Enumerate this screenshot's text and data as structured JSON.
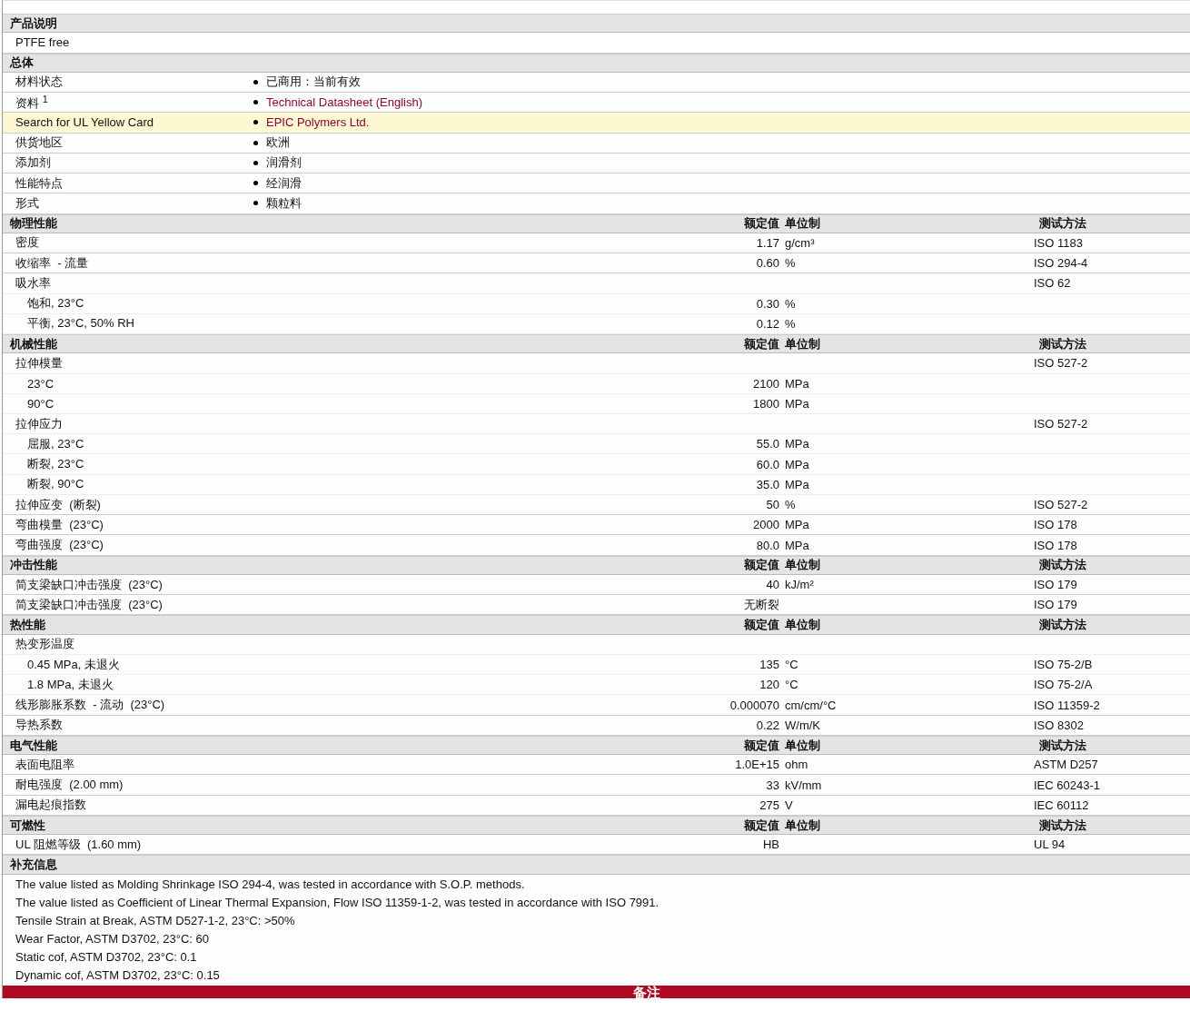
{
  "sections": [
    {
      "title": "产品说明",
      "rows": [
        {
          "kind": "note",
          "text": "PTFE free"
        }
      ]
    },
    {
      "title": "总体",
      "rows": [
        {
          "kind": "info",
          "label": "材料状态",
          "value": "已商用：当前有效",
          "link": false,
          "highlighted": false
        },
        {
          "kind": "info",
          "label": "资料 $^{1}$",
          "value": "Technical Datasheet (English)",
          "link": true,
          "highlighted": false
        },
        {
          "kind": "info",
          "label": "Search for UL Yellow Card",
          "value": "EPIC Polymers Ltd.",
          "link": true,
          "highlighted": true
        },
        {
          "kind": "info",
          "label": "供货地区",
          "value": "欧洲",
          "link": false,
          "highlighted": false
        },
        {
          "kind": "info",
          "label": "添加剂",
          "value": "润滑剂",
          "link": false,
          "highlighted": false
        },
        {
          "kind": "info",
          "label": "性能特点",
          "value": "经润滑",
          "link": false,
          "highlighted": false
        },
        {
          "kind": "info",
          "label": "形式",
          "value": "颗粒料",
          "link": false,
          "highlighted": false
        }
      ]
    },
    {
      "title": "物理性能",
      "columns": {
        "value": "额定值",
        "unit": "单位制",
        "method": "测试方法"
      },
      "rows": [
        {
          "kind": "prop",
          "label": "密度",
          "value": "1.17",
          "unit": "g/cm³",
          "method": "ISO 1183"
        },
        {
          "kind": "prop",
          "label": "收缩率  - 流量",
          "value": "0.60",
          "unit": "%",
          "method": "ISO 294-4"
        },
        {
          "kind": "prop",
          "label": "吸水率",
          "method": "ISO 62",
          "children": [
            {
              "kind": "prop",
              "label": "饱和, 23°C",
              "value": "0.30",
              "unit": "%"
            },
            {
              "kind": "prop",
              "label": "平衡, 23°C, 50% RH",
              "value": "0.12",
              "unit": "%"
            }
          ]
        }
      ]
    },
    {
      "title": "机械性能",
      "columns": {
        "value": "额定值",
        "unit": "单位制",
        "method": "测试方法"
      },
      "rows": [
        {
          "kind": "prop",
          "label": "拉伸模量",
          "method": "ISO 527-2",
          "children": [
            {
              "kind": "prop",
              "label": "23°C",
              "value": "2100",
              "unit": "MPa"
            },
            {
              "kind": "prop",
              "label": "90°C",
              "value": "1800",
              "unit": "MPa"
            }
          ]
        },
        {
          "kind": "prop",
          "label": "拉伸应力",
          "method": "ISO 527-2",
          "children": [
            {
              "kind": "prop",
              "label": "屈服, 23°C",
              "value": "55.0",
              "unit": "MPa"
            },
            {
              "kind": "prop",
              "label": "断裂, 23°C",
              "value": "60.0",
              "unit": "MPa"
            },
            {
              "kind": "prop",
              "label": "断裂, 90°C",
              "value": "35.0",
              "unit": "MPa"
            }
          ]
        },
        {
          "kind": "prop",
          "label": "拉伸应变  (断裂)",
          "value": "50",
          "unit": "%",
          "method": "ISO 527-2"
        },
        {
          "kind": "prop",
          "label": "弯曲模量  (23°C)",
          "value": "2000",
          "unit": "MPa",
          "method": "ISO 178"
        },
        {
          "kind": "prop",
          "label": "弯曲强度  (23°C)",
          "value": "80.0",
          "unit": "MPa",
          "method": "ISO 178"
        }
      ]
    },
    {
      "title": "冲击性能",
      "columns": {
        "value": "额定值",
        "unit": "单位制",
        "method": "测试方法"
      },
      "rows": [
        {
          "kind": "prop",
          "label": "简支梁缺口冲击强度  (23°C)",
          "value": "40",
          "unit": "kJ/m²",
          "method": "ISO 179"
        },
        {
          "kind": "prop",
          "label": "简支梁缺口冲击强度  (23°C)",
          "value": "无断裂",
          "method": "ISO 179"
        }
      ]
    },
    {
      "title": "热性能",
      "columns": {
        "value": "额定值",
        "unit": "单位制",
        "method": "测试方法"
      },
      "rows": [
        {
          "kind": "prop",
          "label": "热变形温度",
          "children": [
            {
              "kind": "prop",
              "label": "0.45 MPa, 未退火",
              "value": "135",
              "unit": "°C",
              "method": "ISO 75-2/B"
            },
            {
              "kind": "prop",
              "label": "1.8 MPa, 未退火",
              "value": "120",
              "unit": "°C",
              "method": "ISO 75-2/A"
            }
          ]
        },
        {
          "kind": "prop",
          "label": "线形膨胀系数  - 流动  (23°C)",
          "value": "0.000070",
          "unit": "cm/cm/°C",
          "method": "ISO 11359-2"
        },
        {
          "kind": "prop",
          "label": "导热系数",
          "value": "0.22",
          "unit": "W/m/K",
          "method": "ISO 8302"
        }
      ]
    },
    {
      "title": "电气性能",
      "columns": {
        "value": "额定值",
        "unit": "单位制",
        "method": "测试方法"
      },
      "rows": [
        {
          "kind": "prop",
          "label": "表面电阻率",
          "value": "1.0E+15",
          "unit": "ohm",
          "method": "ASTM D257"
        },
        {
          "kind": "prop",
          "label": "耐电强度  (2.00 mm)",
          "value": "33",
          "unit": "kV/mm",
          "method": "IEC 60243-1"
        },
        {
          "kind": "prop",
          "label": "漏电起痕指数",
          "value": "275",
          "unit": "V",
          "method": "IEC 60112"
        }
      ]
    },
    {
      "title": "可燃性",
      "columns": {
        "value": "额定值",
        "unit": "单位制",
        "method": "测试方法"
      },
      "rows": [
        {
          "kind": "prop",
          "label": "UL 阻燃等级  (1.60 mm)",
          "value": "HB",
          "method": "UL 94"
        }
      ]
    },
    {
      "title": "补充信息",
      "rows": [
        {
          "kind": "notes",
          "lines": [
            "The value listed as Molding Shrinkage ISO 294-4, was tested in accordance with S.O.P. methods.",
            "The value listed as Coefficient of Linear Thermal Expansion, Flow ISO 11359-1-2, was tested in accordance with ISO 7991.",
            "Tensile Strain at Break, ASTM D527-1-2, 23°C: >50%",
            "Wear Factor, ASTM D3702, 23°C: 60",
            "Static cof, ASTM D3702, 23°C: 0.1",
            "Dynamic cof, ASTM D3702, 23°C: 0.15"
          ]
        }
      ]
    }
  ],
  "footer": {
    "title": "备注"
  }
}
